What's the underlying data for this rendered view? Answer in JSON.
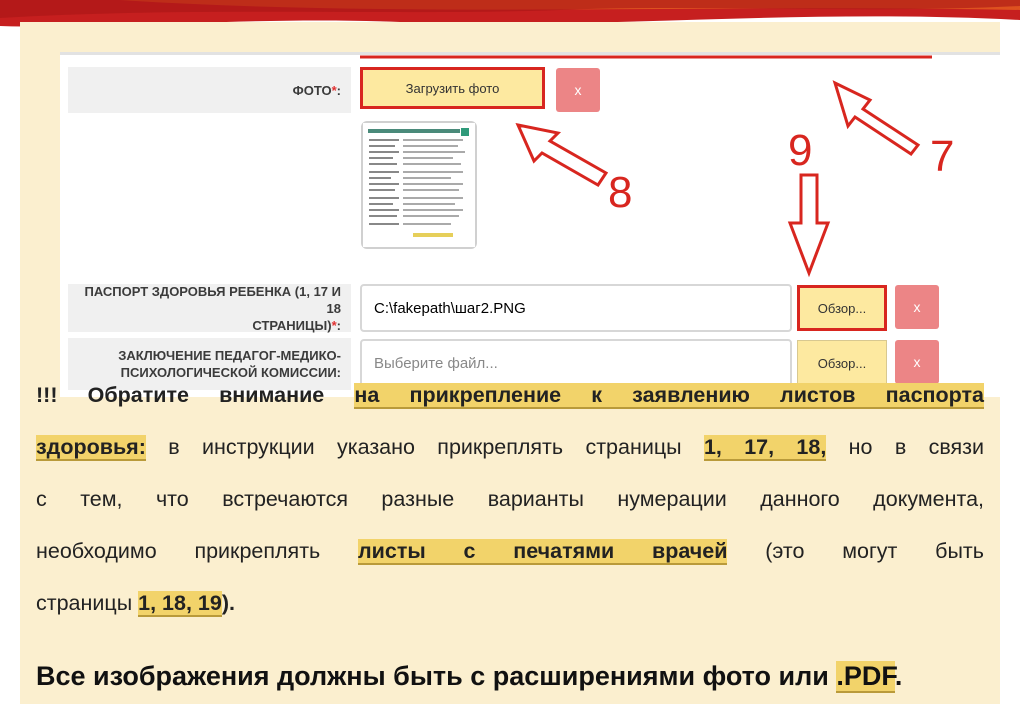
{
  "form": {
    "photo_label": "ФОТО",
    "required_mark": "*",
    "colon": ":",
    "upload_button": "Загрузить фото",
    "delete_symbol": "x",
    "passport_label_line1": "ПАСПОРТ ЗДОРОВЬЯ РЕБЕНКА (1, 17 И 18",
    "passport_label_line2": "СТРАНИЦЫ)",
    "passport_file_value": "C:\\fakepath\\шаг2.PNG",
    "browse_button": "Обзор...",
    "commission_label_line1": "ЗАКЛЮЧЕНИЕ ПЕДАГОГ-МЕДИКО-",
    "commission_label_line2": "ПСИХОЛОГИЧЕСКОЙ КОМИССИИ:",
    "commission_file_placeholder": "Выберите файл..."
  },
  "annotations": {
    "step_7": "7",
    "step_8": "8",
    "step_9": "9"
  },
  "notice": {
    "p1_prefix": "!!! Обратите внимание",
    "p1_highlight": "на прикрепление к заявлению листов паспорта",
    "p2_highlight": "здоровья:",
    "p2_text": "в инструкции указано прикреплять страницы",
    "p2_pages": "1, 17, 18,",
    "p2_suffix": "но в связи",
    "p3_text": "с тем, что встречаются разные варианты нумерации данного документа,",
    "p4_prefix": "необходимо прикреплять",
    "p4_highlight": "листы с печатями врачей",
    "p4_suffix": "(это могут быть",
    "p5_prefix": "страницы",
    "p5_pages": "1, 18, 19",
    "p5_suffix": ")."
  },
  "footer": {
    "text": "Все изображения должны быть с расширениями фото или",
    "ext": ".PDF",
    "end": "."
  },
  "colors": {
    "accent_red": "#d8261f",
    "button_yellow": "#fde9a0",
    "delete_pink": "#ec8586",
    "highlight": "#f2d36a",
    "panel_beige": "#fbefcf"
  }
}
